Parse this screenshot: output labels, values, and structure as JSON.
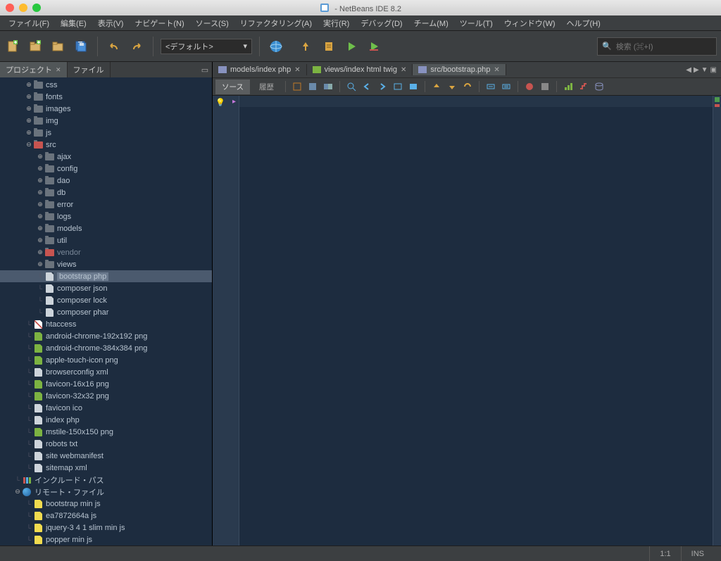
{
  "title": "- NetBeans IDE 8.2",
  "menu": [
    "ファイル(F)",
    "編集(E)",
    "表示(V)",
    "ナビゲート(N)",
    "ソース(S)",
    "リファクタリング(A)",
    "実行(R)",
    "デバッグ(D)",
    "チーム(M)",
    "ツール(T)",
    "ウィンドウ(W)",
    "ヘルプ(H)"
  ],
  "toolbar": {
    "config_combo": "<デフォルト>",
    "search_placeholder": "検索 (⌘+I)"
  },
  "left_tabs": {
    "projects": "プロジェクト",
    "files": "ファイル"
  },
  "tree": [
    {
      "d": 2,
      "t": 1,
      "i": "folder",
      "l": "css"
    },
    {
      "d": 2,
      "t": 1,
      "i": "folder",
      "l": "fonts"
    },
    {
      "d": 2,
      "t": 1,
      "i": "folder",
      "l": "images"
    },
    {
      "d": 2,
      "t": 1,
      "i": "folder",
      "l": "img"
    },
    {
      "d": 2,
      "t": 1,
      "i": "folder",
      "l": "js"
    },
    {
      "d": 2,
      "t": 2,
      "i": "folder-red",
      "l": "src"
    },
    {
      "d": 3,
      "t": 1,
      "i": "folder",
      "l": "ajax"
    },
    {
      "d": 3,
      "t": 1,
      "i": "folder",
      "l": "config"
    },
    {
      "d": 3,
      "t": 1,
      "i": "folder",
      "l": "dao"
    },
    {
      "d": 3,
      "t": 1,
      "i": "folder",
      "l": "db"
    },
    {
      "d": 3,
      "t": 1,
      "i": "folder",
      "l": "error"
    },
    {
      "d": 3,
      "t": 1,
      "i": "folder",
      "l": "logs"
    },
    {
      "d": 3,
      "t": 1,
      "i": "folder",
      "l": "models"
    },
    {
      "d": 3,
      "t": 1,
      "i": "folder",
      "l": "util"
    },
    {
      "d": 3,
      "t": 1,
      "i": "folder-red",
      "l": "vendor",
      "dim": true
    },
    {
      "d": 3,
      "t": 1,
      "i": "folder",
      "l": "views"
    },
    {
      "d": 3,
      "t": 0,
      "i": "php",
      "l": "bootstrap php",
      "sel": true
    },
    {
      "d": 3,
      "t": 0,
      "i": "php",
      "l": "composer json"
    },
    {
      "d": 3,
      "t": 0,
      "i": "php",
      "l": "composer lock"
    },
    {
      "d": 3,
      "t": 0,
      "i": "php",
      "l": "composer phar"
    },
    {
      "d": 2,
      "t": 0,
      "i": "ht",
      "l": "htaccess"
    },
    {
      "d": 2,
      "t": 0,
      "i": "img",
      "l": "android-chrome-192x192 png"
    },
    {
      "d": 2,
      "t": 0,
      "i": "img",
      "l": "android-chrome-384x384 png"
    },
    {
      "d": 2,
      "t": 0,
      "i": "img",
      "l": "apple-touch-icon png"
    },
    {
      "d": 2,
      "t": 0,
      "i": "php",
      "l": "browserconfig xml"
    },
    {
      "d": 2,
      "t": 0,
      "i": "img",
      "l": "favicon-16x16 png"
    },
    {
      "d": 2,
      "t": 0,
      "i": "img",
      "l": "favicon-32x32 png"
    },
    {
      "d": 2,
      "t": 0,
      "i": "php",
      "l": "favicon ico"
    },
    {
      "d": 2,
      "t": 0,
      "i": "php",
      "l": "index php"
    },
    {
      "d": 2,
      "t": 0,
      "i": "img",
      "l": "mstile-150x150 png"
    },
    {
      "d": 2,
      "t": 0,
      "i": "php",
      "l": "robots txt"
    },
    {
      "d": 2,
      "t": 0,
      "i": "php",
      "l": "site webmanifest"
    },
    {
      "d": 2,
      "t": 0,
      "i": "php",
      "l": "sitemap xml"
    },
    {
      "d": 1,
      "t": 0,
      "i": "lib",
      "l": "インクルード・パス"
    },
    {
      "d": 1,
      "t": 2,
      "i": "globe",
      "l": "リモート・ファイル"
    },
    {
      "d": 2,
      "t": 0,
      "i": "js",
      "l": "bootstrap min js"
    },
    {
      "d": 2,
      "t": 0,
      "i": "js",
      "l": "ea7872664a js"
    },
    {
      "d": 2,
      "t": 0,
      "i": "js",
      "l": "jquery-3 4 1 slim min js"
    },
    {
      "d": 2,
      "t": 0,
      "i": "js",
      "l": "popper min js"
    }
  ],
  "editor_tabs": [
    {
      "label": "models/index php",
      "icon": "php"
    },
    {
      "label": "views/index html twig",
      "icon": "twig"
    },
    {
      "label": "src/bootstrap.php",
      "icon": "php",
      "active": true
    }
  ],
  "editor_subtabs": {
    "source": "ソース",
    "history": "履歴"
  },
  "status": {
    "pos": "1:1",
    "ins": "INS"
  }
}
